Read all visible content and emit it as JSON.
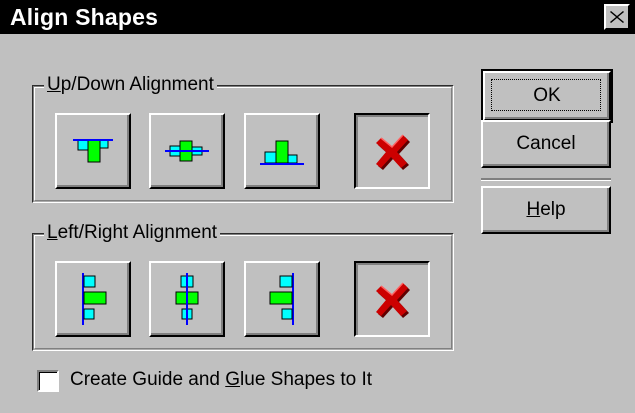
{
  "window": {
    "title": "Align Shapes"
  },
  "updown_group": {
    "legend_pre": "",
    "legend_u": "U",
    "legend_post": "p/Down Alignment",
    "buttons": [
      {
        "name": "align-top-button",
        "icon": "align-top-icon"
      },
      {
        "name": "align-middle-button",
        "icon": "align-middle-icon"
      },
      {
        "name": "align-bottom-button",
        "icon": "align-bottom-icon"
      },
      {
        "name": "no-updown-alignment-button",
        "icon": "red-x-icon",
        "selected": true
      }
    ]
  },
  "leftright_group": {
    "legend_pre": "",
    "legend_u": "L",
    "legend_post": "eft/Right Alignment",
    "buttons": [
      {
        "name": "align-left-button",
        "icon": "align-left-icon"
      },
      {
        "name": "align-center-button",
        "icon": "align-center-icon"
      },
      {
        "name": "align-right-button",
        "icon": "align-right-icon"
      },
      {
        "name": "no-leftright-alignment-button",
        "icon": "red-x-icon",
        "selected": true
      }
    ]
  },
  "buttons": {
    "ok": "OK",
    "cancel": "Cancel",
    "help_u": "H",
    "help_rest": "elp"
  },
  "checkbox": {
    "checked": false,
    "label_pre": "Create Guide and ",
    "label_u": "G",
    "label_post": "lue Shapes to It"
  },
  "colors": {
    "face": "#c0c0c0",
    "shape_cyan": "#00ffff",
    "shape_green": "#00ff00",
    "guide_blue": "#0000ff",
    "x_red": "#cc0000"
  }
}
